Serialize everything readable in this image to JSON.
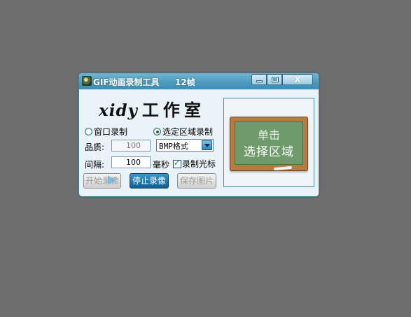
{
  "window": {
    "title": "GIF动画录制工具",
    "frame_count": "12帧",
    "controls": {
      "close": "X"
    }
  },
  "logo": {
    "latin": "xidy",
    "chinese": "工作室"
  },
  "mode": {
    "option_window": "窗口录制",
    "option_region": "选定区域录制",
    "selected": "选定区域录制"
  },
  "quality": {
    "label": "品质:",
    "value": "100",
    "format": "BMP格式"
  },
  "interval": {
    "label": "间隔:",
    "value": "100",
    "unit": "毫秒"
  },
  "record_cursor": {
    "label": "录制光标",
    "checked": true
  },
  "buttons": {
    "start": "开始录像",
    "stop": "停止录像",
    "save": "保存图片"
  },
  "board": {
    "line1": "单击",
    "line2": "选择区域"
  }
}
